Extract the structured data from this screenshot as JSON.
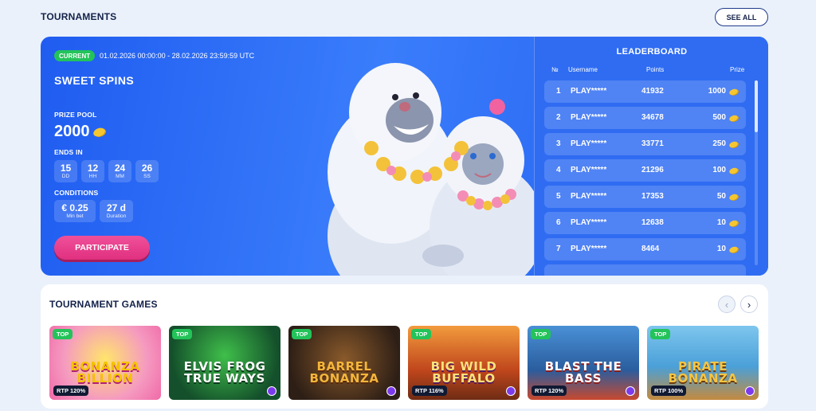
{
  "header": {
    "title": "TOURNAMENTS",
    "see_all": "SEE ALL"
  },
  "tournament": {
    "status": "CURRENT",
    "dates": "01.02.2026 00:00:00 - 28.02.2026 23:59:59 UTC",
    "name": "SWEET SPINS",
    "prize_pool_label": "PRIZE POOL",
    "prize_pool": "2000",
    "ends_in_label": "ENDS IN",
    "countdown": [
      {
        "value": "15",
        "unit": "DD"
      },
      {
        "value": "12",
        "unit": "HH"
      },
      {
        "value": "24",
        "unit": "MM"
      },
      {
        "value": "26",
        "unit": "SS"
      }
    ],
    "conditions_label": "CONDITIONS",
    "conditions": [
      {
        "value": "€ 0.25",
        "unit": "Min bet"
      },
      {
        "value": "27 d",
        "unit": "Duration"
      }
    ],
    "participate": "PARTICIPATE"
  },
  "leaderboard": {
    "title": "LEADERBOARD",
    "columns": {
      "rank": "№",
      "username": "Username",
      "points": "Points",
      "prize": "Prize"
    },
    "rows": [
      {
        "rank": "1",
        "username": "PLAY*****",
        "points": "41932",
        "prize": "1000"
      },
      {
        "rank": "2",
        "username": "PLAY*****",
        "points": "34678",
        "prize": "500"
      },
      {
        "rank": "3",
        "username": "PLAY*****",
        "points": "33771",
        "prize": "250"
      },
      {
        "rank": "4",
        "username": "PLAY*****",
        "points": "21296",
        "prize": "100"
      },
      {
        "rank": "5",
        "username": "PLAY*****",
        "points": "17353",
        "prize": "50"
      },
      {
        "rank": "6",
        "username": "PLAY*****",
        "points": "12638",
        "prize": "10"
      },
      {
        "rank": "7",
        "username": "PLAY*****",
        "points": "8464",
        "prize": "10"
      }
    ]
  },
  "games": {
    "title": "TOURNAMENT GAMES",
    "prev_icon": "chevron-left-icon",
    "next_icon": "chevron-right-icon",
    "items": [
      {
        "name": "BONANZA BILLION",
        "badge": "TOP",
        "rtp": "RTP 120%"
      },
      {
        "name": "ELVIS FROG TRUE WAYS",
        "badge": "TOP",
        "rtp": ""
      },
      {
        "name": "BARREL BONANZA",
        "badge": "TOP",
        "rtp": ""
      },
      {
        "name": "BIG WILD BUFFALO",
        "badge": "TOP",
        "rtp": "RTP 116%"
      },
      {
        "name": "BLAST THE BASS",
        "badge": "TOP",
        "rtp": "RTP 120%"
      },
      {
        "name": "PIRATE BONANZA",
        "badge": "TOP",
        "rtp": "RTP 100%"
      }
    ]
  },
  "colors": {
    "accent": "#2f6cf2",
    "participate": "#e0307f",
    "badge": "#23c35a",
    "coin": "#f6c630"
  }
}
